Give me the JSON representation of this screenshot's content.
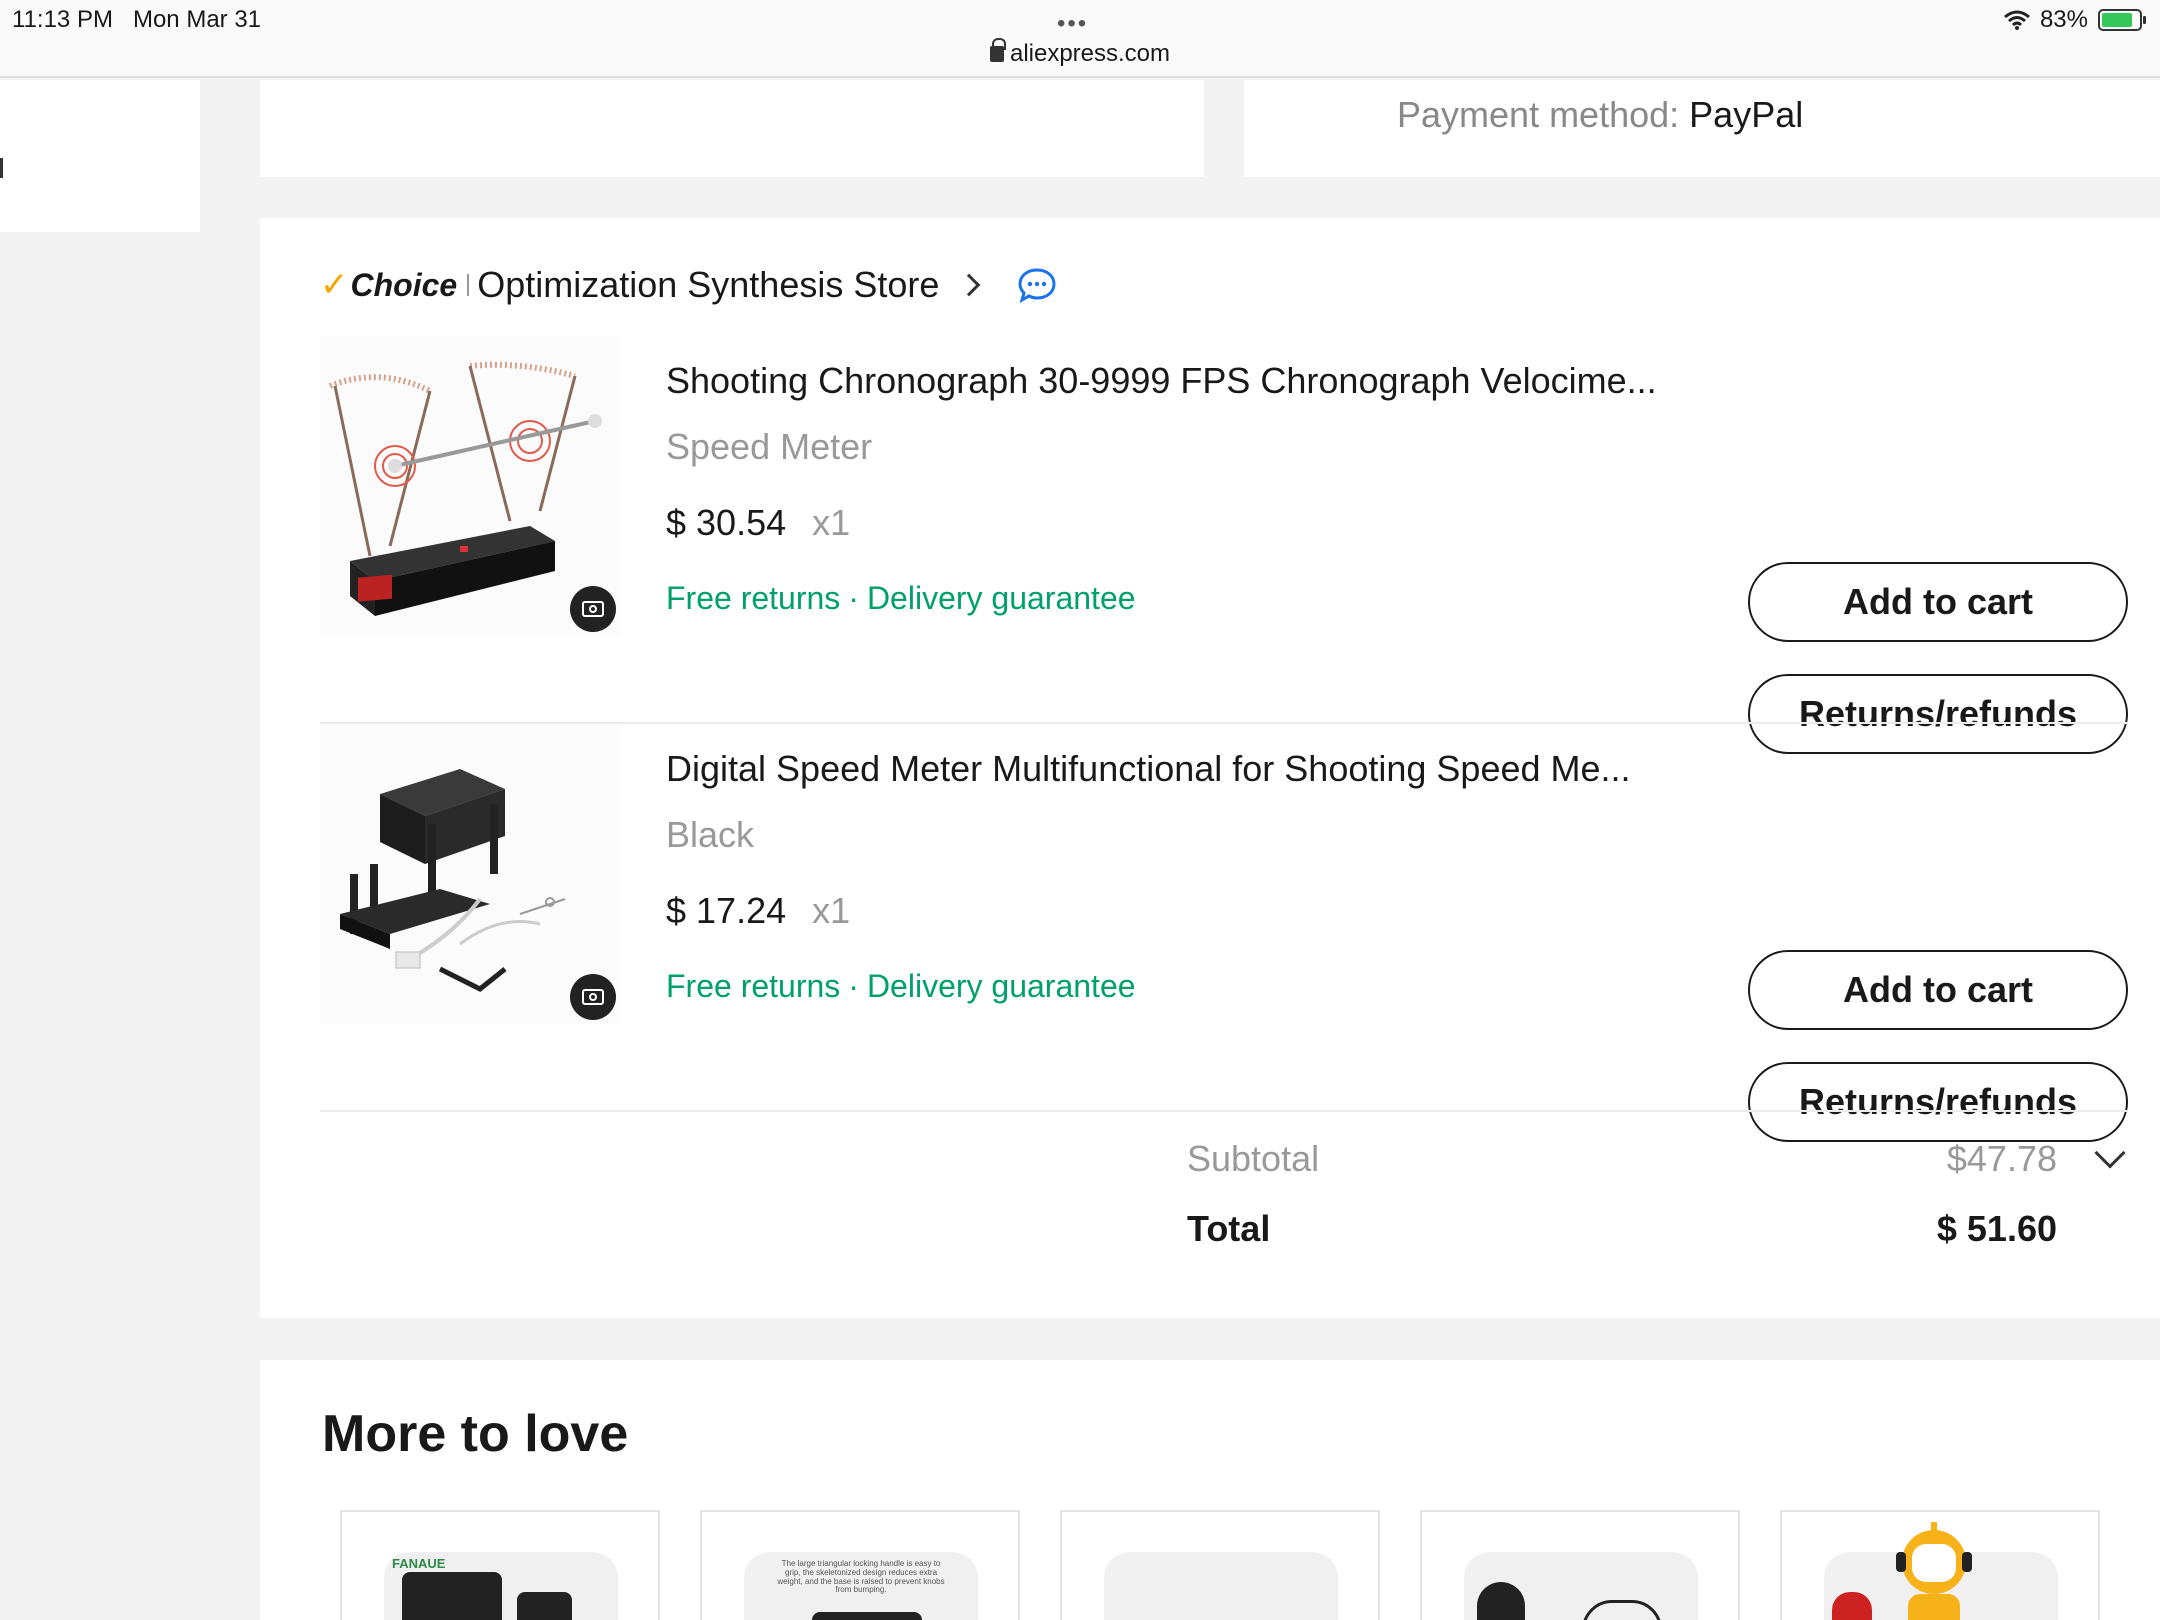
{
  "status_bar": {
    "time": "11:13 PM",
    "date": "Mon Mar 31",
    "url": "aliexpress.com",
    "battery": "83%",
    "battery_level": 0.83,
    "icons": [
      "wifi-icon",
      "lock-icon",
      "battery-charging-icon"
    ]
  },
  "payment": {
    "label": "Payment method:",
    "value": "PayPal"
  },
  "store": {
    "badge": "Choice",
    "name": "Optimization Synthesis Store"
  },
  "items": [
    {
      "title": "Shooting Chronograph 30-9999 FPS Chronograph Velocime...",
      "variant": "Speed Meter",
      "price": "$ 30.54",
      "qty": "x1",
      "perk1": "Free returns",
      "perk_sep": "·",
      "perk2": "Delivery guarantee",
      "add_to_cart": "Add to cart",
      "returns": "Returns/refunds"
    },
    {
      "title": "Digital Speed Meter Multifunctional for Shooting Speed Me...",
      "variant": "Black",
      "price": "$ 17.24",
      "qty": "x1",
      "perk1": "Free returns",
      "perk_sep": "·",
      "perk2": "Delivery guarantee",
      "add_to_cart": "Add to cart",
      "returns": "Returns/refunds"
    }
  ],
  "totals": {
    "subtotal_label": "Subtotal",
    "subtotal_value": "$47.78",
    "total_label": "Total",
    "total_value": "$ 51.60"
  },
  "more_to_love": {
    "title": "More to love",
    "rec1_brand": "FANAUE",
    "rec2_caption": "The large triangular locking handle is easy to grip, the skeletonized design reduces extra weight, and the base is raised to prevent knobs from bumping."
  },
  "colors": {
    "accent_green": "#00a06c",
    "choice_check": "#f7a600",
    "chat_blue": "#1a73e8",
    "background": "#f3f3f3"
  }
}
